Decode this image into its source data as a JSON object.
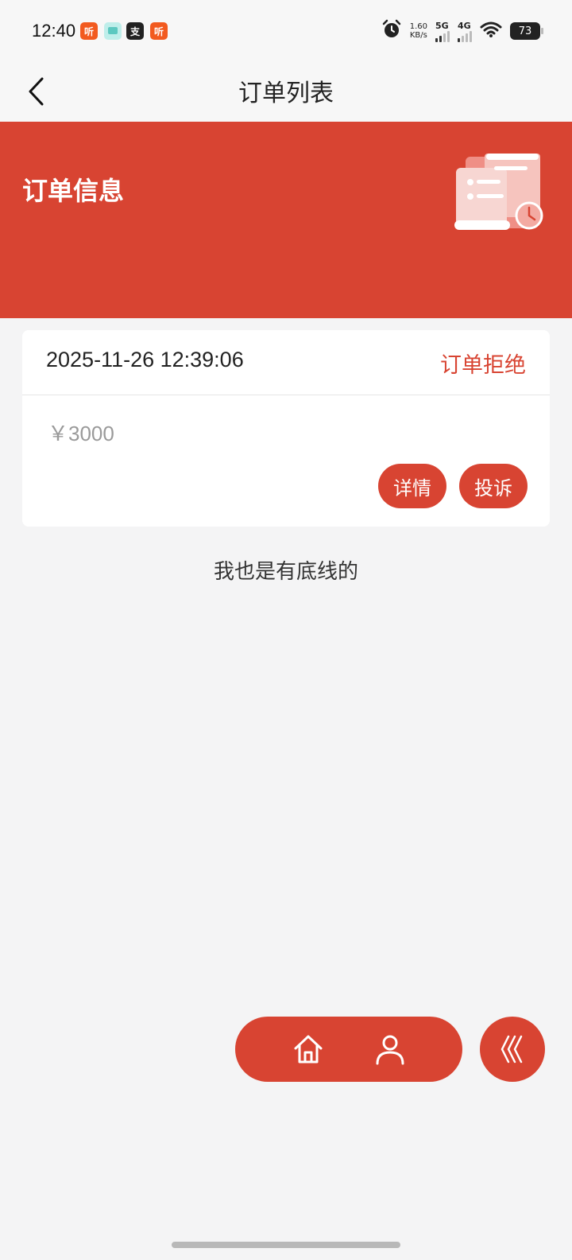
{
  "status_bar": {
    "time": "12:40",
    "apps": [
      {
        "icon": "ting-app-icon",
        "label": "听",
        "color": "#f25a1f"
      },
      {
        "icon": "message-app-icon",
        "label": "",
        "color": "#7fd6d0"
      },
      {
        "icon": "alipay-app-icon",
        "label": "支",
        "color": "#222222"
      },
      {
        "icon": "ting-app-icon",
        "label": "听",
        "color": "#f25a1f"
      }
    ],
    "net_speed_value": "1.60",
    "net_speed_unit": "KB/s",
    "signal_1": "5G",
    "signal_2": "4G",
    "battery": "73"
  },
  "header": {
    "title": "订单列表"
  },
  "banner": {
    "title": "订单信息",
    "color": "#d84432"
  },
  "orders": [
    {
      "datetime": "2025-11-26 12:39:06",
      "status": "订单拒绝",
      "amount": "￥3000",
      "actions": [
        "详情",
        "投诉"
      ]
    }
  ],
  "list_end_text": "我也是有底线的",
  "floating_nav": {
    "items": [
      "home-icon",
      "user-icon"
    ],
    "collapse": "chevrons-left-icon"
  },
  "colors": {
    "accent": "#d84432",
    "background": "#f4f4f5"
  }
}
